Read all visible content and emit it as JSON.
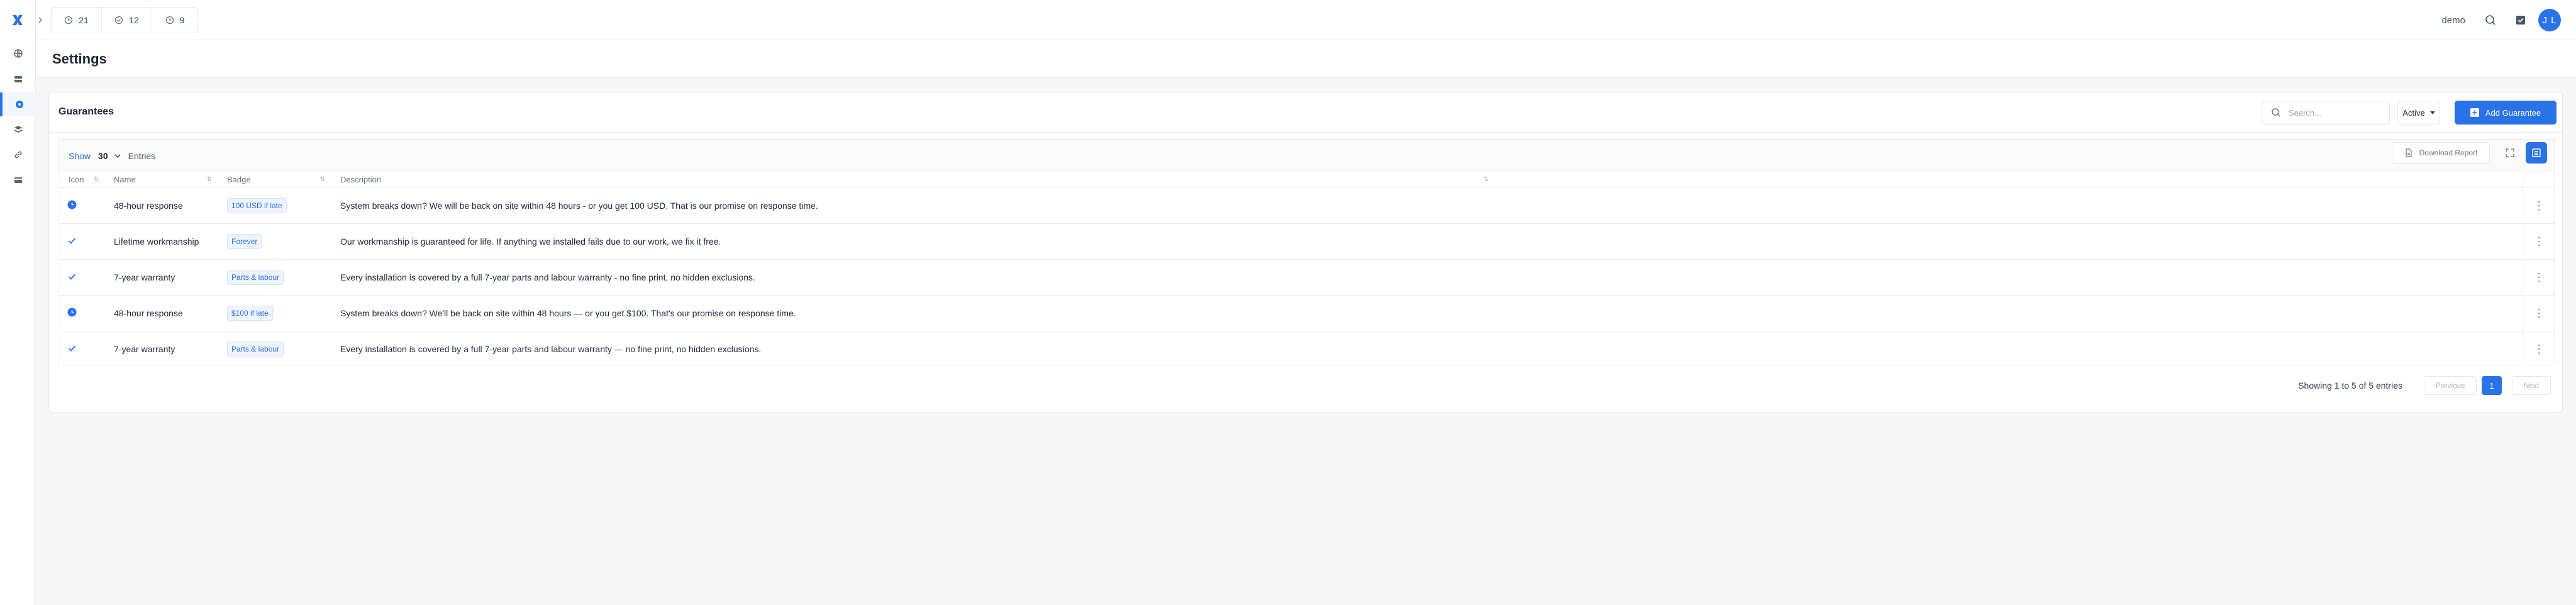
{
  "header": {
    "counters": [
      {
        "icon": "clock-icon",
        "value": "21"
      },
      {
        "icon": "check-circle-icon",
        "value": "12"
      },
      {
        "icon": "clock-icon",
        "value": "9"
      }
    ],
    "user_label": "demo",
    "avatar_initials": "J L"
  },
  "sidebar": {
    "items": [
      {
        "icon": "globe-icon"
      },
      {
        "icon": "list-icon"
      },
      {
        "icon": "settings-icon",
        "active": true
      },
      {
        "icon": "layers-icon"
      },
      {
        "icon": "link-icon"
      },
      {
        "icon": "card-icon"
      }
    ]
  },
  "page": {
    "title": "Settings"
  },
  "card": {
    "title": "Guarantees",
    "search_placeholder": "Search...",
    "status_value": "Active",
    "add_label": "Add Guarantee"
  },
  "table": {
    "show_label": "Show",
    "length_value": "30",
    "entries_label": "Entries",
    "download_label": "Download Report",
    "columns": [
      "Icon",
      "Name",
      "Badge",
      "Description"
    ],
    "rows": [
      {
        "icon": "clock-filled-icon",
        "name": "48-hour response",
        "badge": "100 USD if late",
        "description": "System breaks down? We will be back on site within 48 hours - or you get 100 USD. That is our promise on response time."
      },
      {
        "icon": "check-icon",
        "name": "Lifetime workmanship",
        "badge": "Forever",
        "description": "Our workmanship is guaranteed for life. If anything we installed fails due to our work, we fix it free."
      },
      {
        "icon": "check-icon",
        "name": "7-year warranty",
        "badge": "Parts & labour",
        "description": "Every installation is covered by a full 7-year parts and labour warranty - no fine print, no hidden exclusions."
      },
      {
        "icon": "clock-filled-icon",
        "name": "48-hour response",
        "badge": "$100 if late",
        "description": "System breaks down? We'll be back on site within 48 hours — or you get $100. That's our promise on response time."
      },
      {
        "icon": "check-icon",
        "name": "7-year warranty",
        "badge": "Parts & labour",
        "description": "Every installation is covered by a full 7-year parts and labour warranty — no fine print, no hidden exclusions."
      }
    ],
    "info": "Showing 1 to 5 of 5 entries",
    "prev_label": "Previous",
    "current_page": "1",
    "next_label": "Next"
  },
  "colors": {
    "accent": "#2a72e8",
    "border": "#ececef",
    "background": "#f7f7f8"
  }
}
